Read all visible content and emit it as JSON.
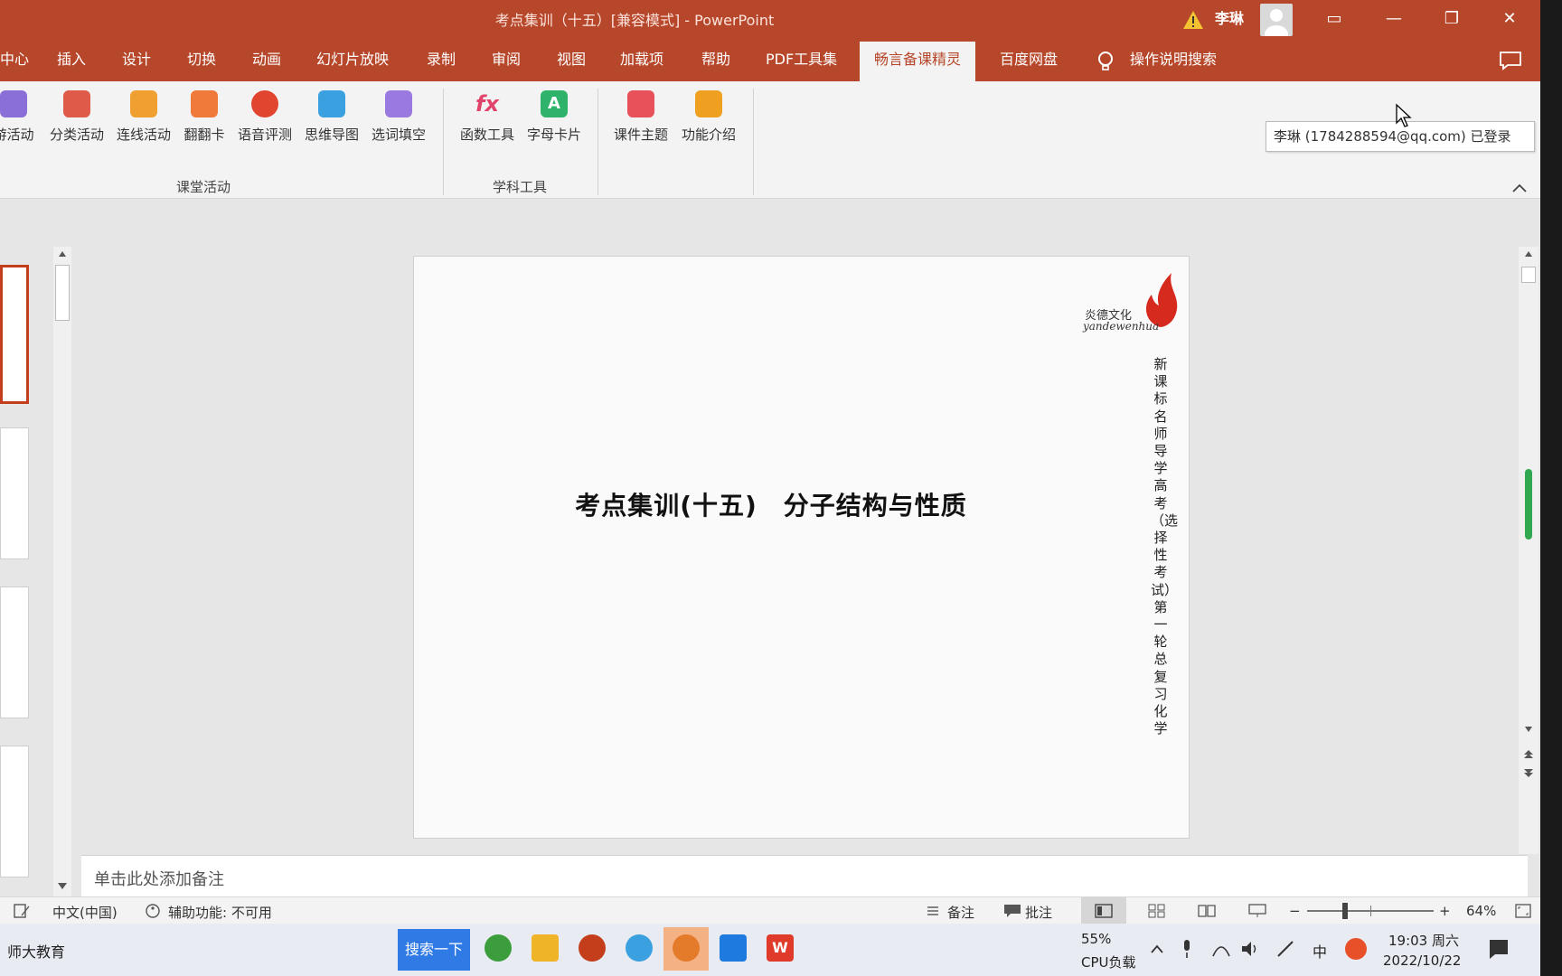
{
  "window": {
    "title": "考点集训（十五）[兼容模式] - PowerPoint",
    "user": "李琳",
    "buttons": {
      "ribbon_display": "▭",
      "minimize": "—",
      "restore": "❐",
      "close": "✕"
    }
  },
  "tabs": [
    {
      "label": "中心"
    },
    {
      "label": "插入"
    },
    {
      "label": "设计"
    },
    {
      "label": "切换"
    },
    {
      "label": "动画"
    },
    {
      "label": "幻灯片放映"
    },
    {
      "label": "录制"
    },
    {
      "label": "审阅"
    },
    {
      "label": "视图"
    },
    {
      "label": "加载项"
    },
    {
      "label": "帮助"
    },
    {
      "label": "PDF工具集"
    },
    {
      "label": "畅言备课精灵"
    },
    {
      "label": "百度网盘"
    },
    {
      "label": "操作说明搜索"
    }
  ],
  "ribbon": {
    "buttons": [
      {
        "label": "游活动",
        "icon": "activity-icon",
        "color": "#8a6fd8"
      },
      {
        "label": "分类活动",
        "icon": "classify-icon",
        "color": "#e05a4a"
      },
      {
        "label": "连线活动",
        "icon": "connect-icon",
        "color": "#f0a030"
      },
      {
        "label": "翻翻卡",
        "icon": "flipcard-icon",
        "color": "#f07a3a"
      },
      {
        "label": "语音评测",
        "icon": "voice-icon",
        "color": "#e2452f"
      },
      {
        "label": "思维导图",
        "icon": "mindmap-icon",
        "color": "#3aa0e0"
      },
      {
        "label": "选词填空",
        "icon": "fillblank-icon",
        "color": "#9a7ae0"
      },
      {
        "label": "函数工具",
        "icon": "function-icon",
        "color": "#e0446a"
      },
      {
        "label": "字母卡片",
        "icon": "lettercard-icon",
        "color": "#2fb36a"
      },
      {
        "label": "课件主题",
        "icon": "theme-icon",
        "color": "#e8505a"
      },
      {
        "label": "功能介绍",
        "icon": "intro-icon",
        "color": "#f0a020"
      }
    ],
    "groups": [
      {
        "label": "课堂活动"
      },
      {
        "label": "学科工具"
      }
    ],
    "tooltip": "李琳 (1784288594@qq.com) 已登录"
  },
  "slide": {
    "title": "考点集训(十五)　分子结构与性质",
    "vertical_text": "新课标　名师导学　高考（选择性考试）第一轮总复习　化学",
    "logo_cn": "炎德文化",
    "logo_en": "yandewenhua"
  },
  "notes": {
    "placeholder": "单击此处添加备注"
  },
  "statusbar": {
    "language": "中文(中国)",
    "accessibility": "辅助功能: 不可用",
    "notes": "备注",
    "comments": "批注",
    "zoom_minus": "−",
    "zoom_plus": "+",
    "zoom": "64%",
    "zoom_level_percent": 64
  },
  "taskbar": {
    "start_label": "师大教育",
    "search_button": "搜索一下",
    "cpu_percent": "55%",
    "cpu_label": "CPU负载",
    "ime": "中",
    "time": "19:03 周六",
    "date": "2022/10/22"
  },
  "colors": {
    "accent": "#b7472a",
    "selected_thumb": "#c43e1c"
  }
}
